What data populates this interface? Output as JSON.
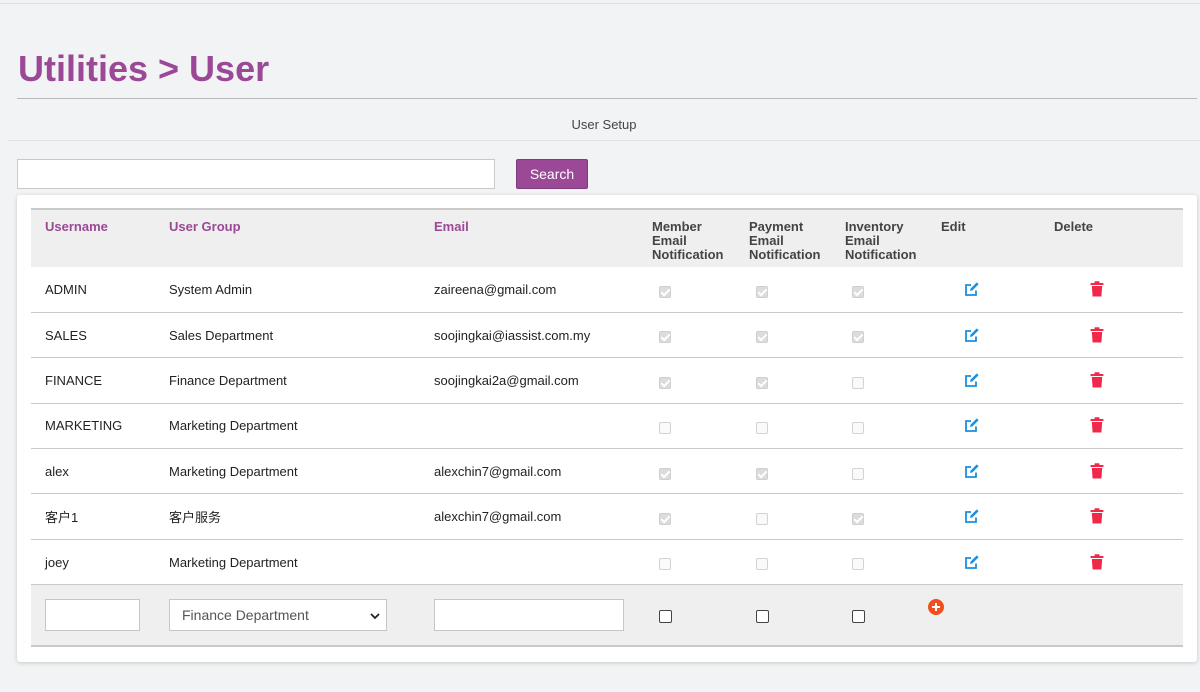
{
  "page": {
    "title": "Utilities > User",
    "section": "User Setup"
  },
  "search": {
    "placeholder": "",
    "value": "",
    "button_label": "Search"
  },
  "table": {
    "headers": {
      "username": "Username",
      "user_group": "User Group",
      "email": "Email",
      "member": [
        "Member",
        "Email",
        "Notification"
      ],
      "payment": [
        "Payment",
        "Email",
        "Notification"
      ],
      "inventory": [
        "Inventory",
        "Email",
        "Notification"
      ],
      "edit": "Edit",
      "delete": "Delete"
    },
    "rows": [
      {
        "username": "ADMIN",
        "group": "System Admin",
        "email": "zaireena@gmail.com",
        "member": true,
        "payment": true,
        "inventory": true
      },
      {
        "username": "SALES",
        "group": "Sales Department",
        "email": "soojingkai@iassist.com.my",
        "member": true,
        "payment": true,
        "inventory": true
      },
      {
        "username": "FINANCE",
        "group": "Finance Department",
        "email": "soojingkai2a@gmail.com",
        "member": true,
        "payment": true,
        "inventory": false
      },
      {
        "username": "MARKETING",
        "group": "Marketing Department",
        "email": "",
        "member": false,
        "payment": false,
        "inventory": false
      },
      {
        "username": "alex",
        "group": "Marketing Department",
        "email": "alexchin7@gmail.com",
        "member": true,
        "payment": true,
        "inventory": false
      },
      {
        "username": "客户1",
        "group": "客户服务",
        "email": "alexchin7@gmail.com",
        "member": true,
        "payment": false,
        "inventory": true
      },
      {
        "username": "joey",
        "group": "Marketing Department",
        "email": "",
        "member": false,
        "payment": false,
        "inventory": false
      }
    ],
    "new_row": {
      "username_value": "",
      "group_selected": "Finance Department",
      "email_value": "",
      "member": false,
      "payment": false,
      "inventory": false
    }
  },
  "colors": {
    "accent": "#9b4896",
    "edit": "#1a8fe0",
    "delete": "#f0284a",
    "add": "#f0501e"
  },
  "icons": {
    "edit": "edit-icon",
    "delete": "trash-icon",
    "add": "add-circle-icon",
    "select": "chevron-down-icon"
  }
}
